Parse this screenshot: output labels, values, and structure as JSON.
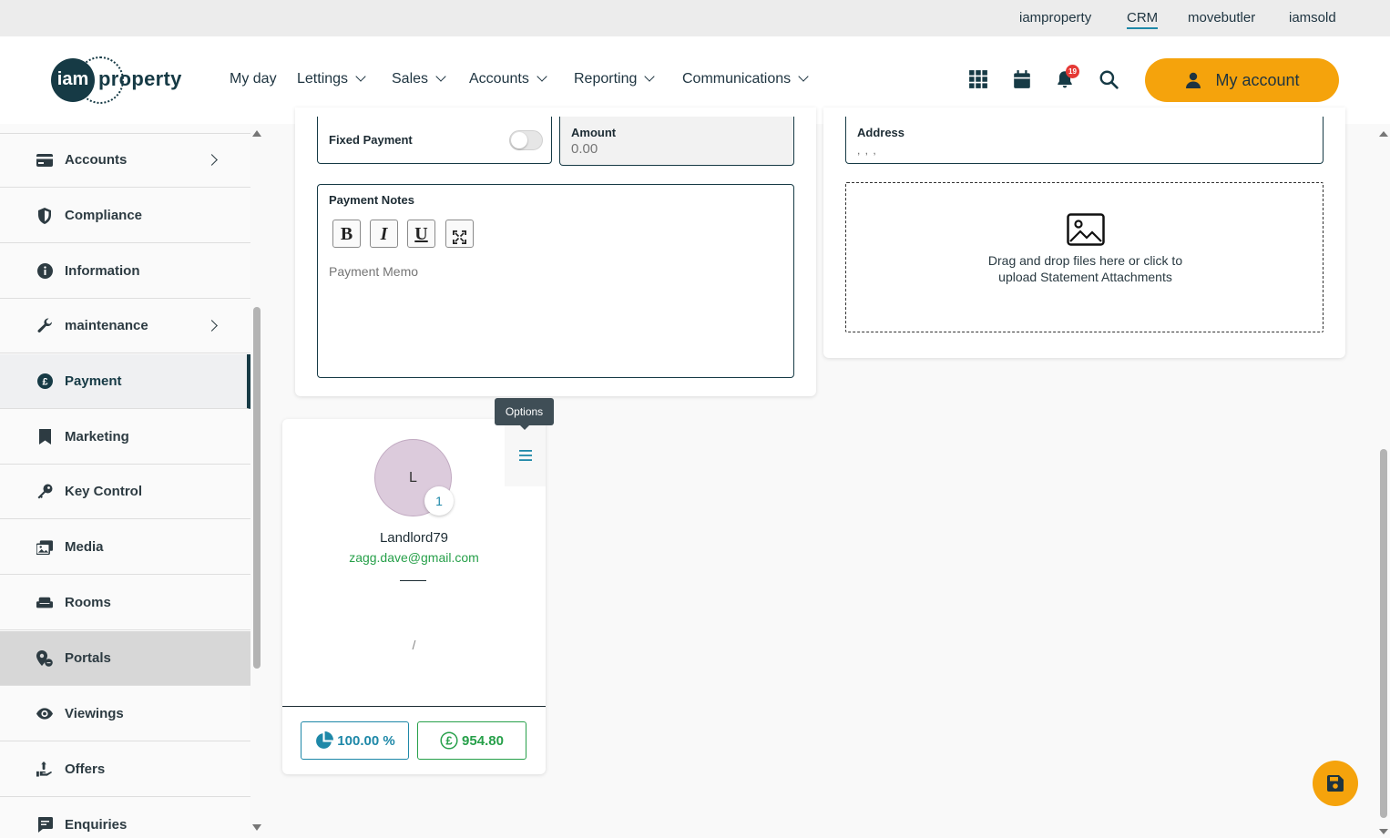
{
  "top_links": [
    {
      "label": "iamproperty"
    },
    {
      "label": "CRM"
    },
    {
      "label": "movebutler"
    },
    {
      "label": "iamsold"
    }
  ],
  "logo": {
    "mark": "iam",
    "text": "property"
  },
  "nav": {
    "items": [
      {
        "label": "My day"
      },
      {
        "label": "Lettings"
      },
      {
        "label": "Sales"
      },
      {
        "label": "Accounts"
      },
      {
        "label": "Reporting"
      },
      {
        "label": "Communications"
      }
    ]
  },
  "header_icons": {
    "notification_count": "19"
  },
  "my_account": {
    "label": "My account"
  },
  "sidebar": {
    "items": [
      {
        "label": "Accounts",
        "icon": "credit-card-icon",
        "has_chevron": true
      },
      {
        "label": "Compliance",
        "icon": "shield-icon",
        "has_chevron": false
      },
      {
        "label": "Information",
        "icon": "info-icon",
        "has_chevron": false
      },
      {
        "label": "maintenance",
        "icon": "wrench-icon",
        "has_chevron": true
      },
      {
        "label": "Payment",
        "icon": "pound-icon",
        "has_chevron": false,
        "selected": true
      },
      {
        "label": "Marketing",
        "icon": "bookmark-icon",
        "has_chevron": false
      },
      {
        "label": "Key Control",
        "icon": "key-icon",
        "has_chevron": false
      },
      {
        "label": "Media",
        "icon": "images-icon",
        "has_chevron": false
      },
      {
        "label": "Rooms",
        "icon": "couch-icon",
        "has_chevron": false
      },
      {
        "label": "Portals",
        "icon": "map-pin-icon",
        "has_chevron": false,
        "hovered": true
      },
      {
        "label": "Viewings",
        "icon": "eye-icon",
        "has_chevron": false
      },
      {
        "label": "Offers",
        "icon": "hand-holding-icon",
        "has_chevron": false
      },
      {
        "label": "Enquiries",
        "icon": "comment-icon",
        "has_chevron": false
      }
    ]
  },
  "payment_form": {
    "fixed_payment_label": "Fixed Payment",
    "fixed_payment_on": false,
    "amount_label": "Amount",
    "amount_placeholder": "0.00",
    "notes_label": "Payment Notes",
    "format_buttons": [
      {
        "label": "B"
      },
      {
        "label": "I"
      },
      {
        "label": "U"
      }
    ],
    "memo_placeholder": "Payment Memo"
  },
  "address_panel": {
    "address_label": "Address",
    "address_value": ", , ,",
    "dropzone_text_line1": "Drag and drop files here or click to",
    "dropzone_text_line2": "upload Statement Attachments"
  },
  "landlord_card": {
    "tooltip": "Options",
    "avatar_initial": "L",
    "badge_count": "1",
    "name": "Landlord79",
    "email": "zagg.dave@gmail.com",
    "divider_text": "/",
    "share_percent": "100.00 %",
    "amount": "954.80",
    "share_color": "#1e88a8",
    "amount_color": "#27a04a"
  }
}
